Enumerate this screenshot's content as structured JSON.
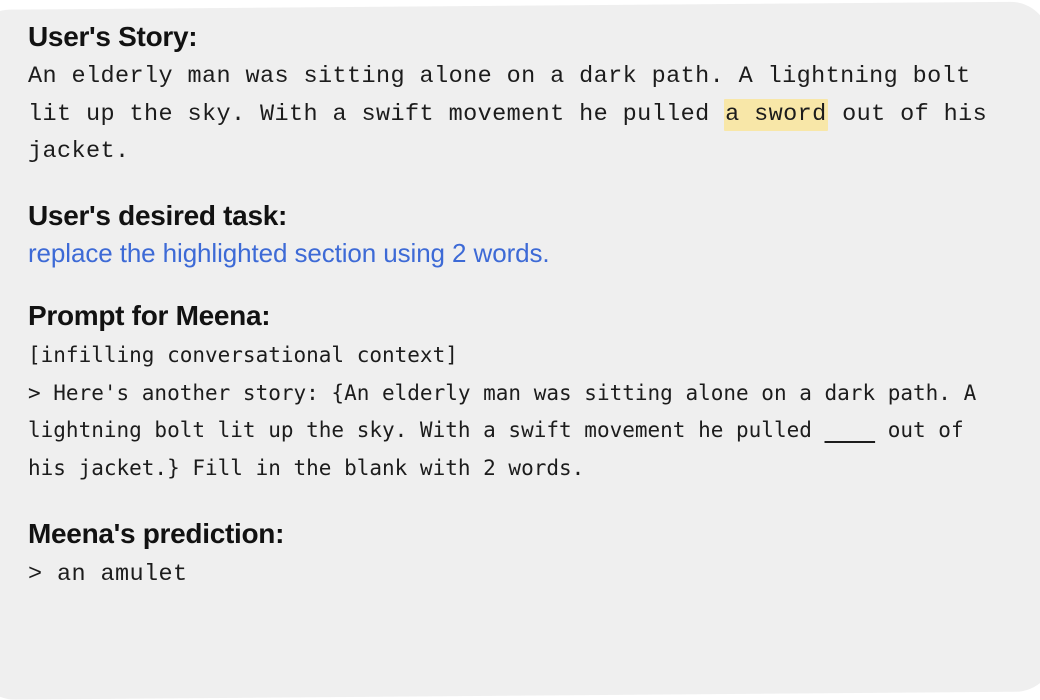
{
  "card": {
    "background_color": "#efefef",
    "page_background_color": "#ffffff",
    "corner_radius_px": 40
  },
  "colors": {
    "heading": "#121212",
    "body_text": "#1c1c1c",
    "task_blue": "#3d6ad6",
    "highlight_yellow": "#f8e7a8"
  },
  "sections": {
    "story": {
      "heading": "User's Story:",
      "text_before_highlight": "An elderly man was sitting alone on a dark path. A lightning bolt lit up the sky. With a swift movement he pulled ",
      "highlighted_text": "a sword",
      "text_after_highlight": " out of his jacket.",
      "full_text": "An elderly man was sitting alone on a dark path. A lightning bolt lit up the sky. With a swift movement he pulled a sword out of his jacket."
    },
    "task": {
      "heading": "User's desired task:",
      "text": "replace the highlighted section using 2 words."
    },
    "prompt": {
      "heading": "Prompt for Meena:",
      "context_tag": "[infilling conversational context]",
      "body_before_blank": "> Here's another story: {An elderly man was sitting alone on a dark path. A lightning bolt lit up the sky. With a swift movement he pulled ",
      "blank_placeholder": "    ",
      "body_after_blank": " out of his jacket.} Fill in the blank with 2 words.",
      "full_body": "> Here's another story: {An elderly man was sitting alone on a dark path. A lightning bolt lit up the sky. With a swift movement he pulled ____ out of his jacket.} Fill in the blank with 2 words."
    },
    "prediction": {
      "heading": "Meena's prediction:",
      "text": "> an amulet"
    }
  }
}
